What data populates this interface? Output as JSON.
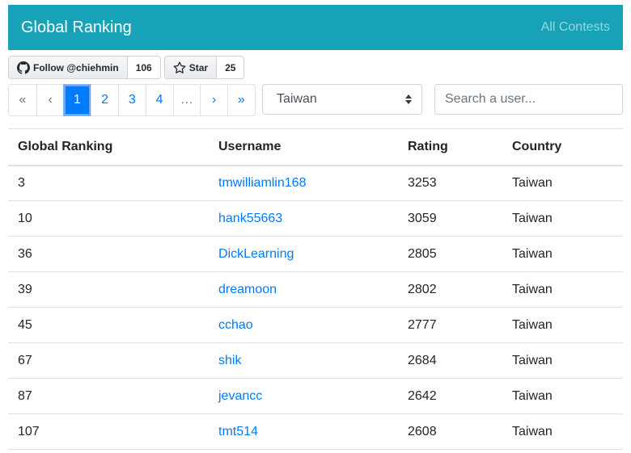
{
  "navbar": {
    "brand": "Global Ranking",
    "link": "All Contests"
  },
  "github": {
    "follow_label": "Follow @chiehmin",
    "follow_count": "106",
    "star_label": "Star",
    "star_count": "25"
  },
  "pagination": {
    "first": "«",
    "prev": "‹",
    "pages": [
      "1",
      "2",
      "3",
      "4"
    ],
    "ellipsis": "…",
    "next": "›",
    "last": "»",
    "active_page": "1"
  },
  "filter": {
    "country_selected": "Taiwan"
  },
  "search": {
    "placeholder": "Search a user..."
  },
  "table": {
    "headers": [
      "Global Ranking",
      "Username",
      "Rating",
      "Country"
    ],
    "rows": [
      {
        "rank": "3",
        "username": "tmwilliamlin168",
        "rating": "3253",
        "country": "Taiwan"
      },
      {
        "rank": "10",
        "username": "hank55663",
        "rating": "3059",
        "country": "Taiwan"
      },
      {
        "rank": "36",
        "username": "DickLearning",
        "rating": "2805",
        "country": "Taiwan"
      },
      {
        "rank": "39",
        "username": "dreamoon",
        "rating": "2802",
        "country": "Taiwan"
      },
      {
        "rank": "45",
        "username": "cchao",
        "rating": "2777",
        "country": "Taiwan"
      },
      {
        "rank": "67",
        "username": "shik",
        "rating": "2684",
        "country": "Taiwan"
      },
      {
        "rank": "87",
        "username": "jevancc",
        "rating": "2642",
        "country": "Taiwan"
      },
      {
        "rank": "107",
        "username": "tmt514",
        "rating": "2608",
        "country": "Taiwan"
      }
    ]
  },
  "colors": {
    "navbar": "#17a2b8",
    "link": "#007bff",
    "active_page": "#007bff"
  },
  "icons": {
    "follow": "github-icon",
    "star": "star-icon",
    "select": "select-caret-icon"
  }
}
